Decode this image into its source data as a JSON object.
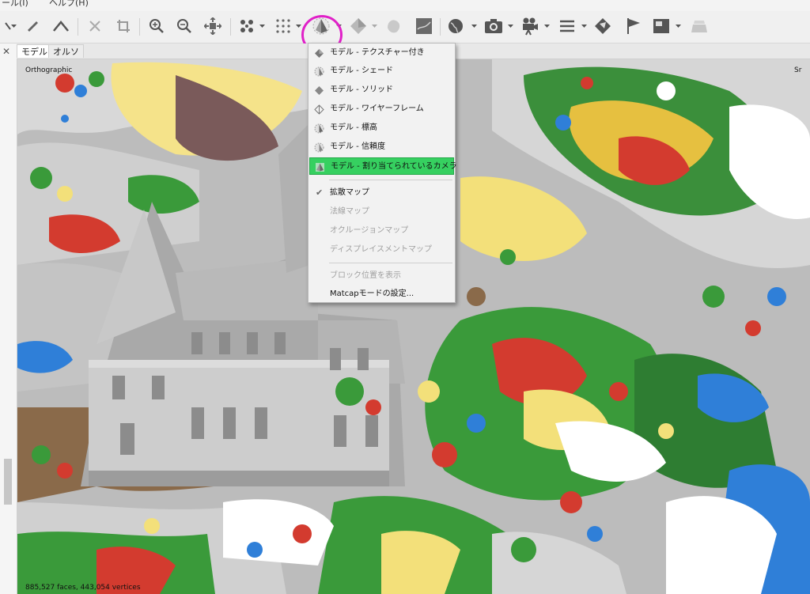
{
  "menubar": {
    "items": [
      "ール(I)",
      "ヘルプ(H)"
    ]
  },
  "toolbar": {
    "buttons": [
      {
        "icon": "select-icon"
      },
      {
        "icon": "ruler-icon"
      },
      {
        "icon": "angle-icon"
      },
      {
        "icon": "delete-icon"
      },
      {
        "icon": "crop-icon"
      },
      {
        "icon": "zoom-in-icon"
      },
      {
        "icon": "zoom-out-icon"
      },
      {
        "icon": "fit-view-icon"
      },
      {
        "icon": "point-cloud-icon"
      },
      {
        "icon": "dense-cloud-icon"
      },
      {
        "icon": "model-textured-icon"
      },
      {
        "icon": "model-solid-icon"
      },
      {
        "icon": "tiled-model-icon"
      },
      {
        "icon": "dem-icon"
      },
      {
        "icon": "globe-icon"
      },
      {
        "icon": "camera-icon"
      },
      {
        "icon": "video-camera-icon"
      },
      {
        "icon": "shapes-icon"
      },
      {
        "icon": "markers-icon"
      },
      {
        "icon": "flag-icon"
      },
      {
        "icon": "image-icon"
      },
      {
        "icon": "layers-icon"
      }
    ],
    "highlight_color": "#e020c8"
  },
  "tabs": [
    {
      "label": "モデル",
      "active": true
    },
    {
      "label": "オルソ",
      "active": false
    }
  ],
  "viewport": {
    "projection_label": "Orthographic",
    "stats": "885,527 faces, 443,054 vertices",
    "corner_label": "Sr"
  },
  "menu": {
    "items": [
      {
        "label": "モデル - テクスチャー付き",
        "icon": "textured-model-icon",
        "state": "normal"
      },
      {
        "label": "モデル - シェード",
        "icon": "shaded-model-icon",
        "state": "normal"
      },
      {
        "label": "モデル - ソリッド",
        "icon": "solid-model-icon",
        "state": "normal"
      },
      {
        "label": "モデル - ワイヤーフレーム",
        "icon": "wireframe-model-icon",
        "state": "normal"
      },
      {
        "label": "モデル - 標高",
        "icon": "elevation-model-icon",
        "state": "normal"
      },
      {
        "label": "モデル - 信頼度",
        "icon": "confidence-model-icon",
        "state": "normal"
      },
      {
        "label": "モデル - 割り当てられているカメラ",
        "icon": "assigned-cameras-model-icon",
        "state": "selected"
      },
      {
        "label": "拡散マップ",
        "icon": "check-icon",
        "state": "checked"
      },
      {
        "label": "法線マップ",
        "state": "disabled"
      },
      {
        "label": "オクルージョンマップ",
        "state": "disabled"
      },
      {
        "label": "ディスプレイスメントマップ",
        "state": "disabled"
      },
      {
        "label": "ブロック位置を表示",
        "state": "disabled"
      },
      {
        "label": "Matcapモードの設定...",
        "state": "normal"
      }
    ],
    "selected_color": "#36d060"
  }
}
